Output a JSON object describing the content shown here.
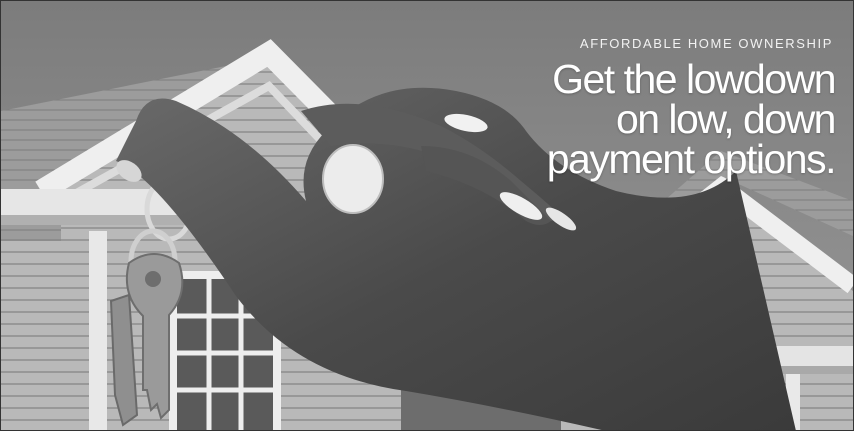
{
  "banner": {
    "eyebrow": "AFFORDABLE HOME OWNERSHIP",
    "headline": [
      "Get the lowdown",
      "on low, down",
      "payment options."
    ]
  },
  "photo": {
    "description_icon": "hand-holding-house-keys-icon",
    "tone": "grayscale"
  }
}
